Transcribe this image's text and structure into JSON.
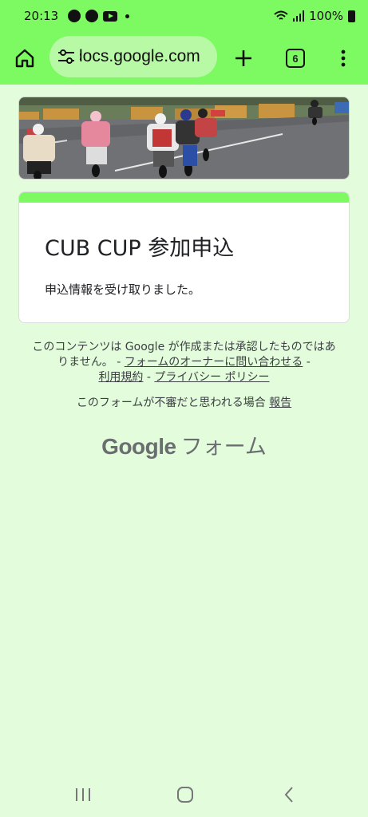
{
  "status_bar": {
    "time": "20:13",
    "battery": "100%",
    "notification_icons": [
      "chrome-icon",
      "line-icon",
      "youtube-icon"
    ]
  },
  "browser": {
    "url": "docs.google.com",
    "tab_count": "6"
  },
  "form": {
    "title": "CUB CUP 参加申込",
    "confirmation": "申込情報を受け取りました。",
    "accent_color": "#7dfa62",
    "background_color": "#e3fcdc"
  },
  "footer": {
    "disclaimer_prefix": "このコンテンツは Google が作成または承認したものではありません。 - ",
    "contact_owner": "フォームのオーナーに問い合わせる",
    "terms": "利用規約",
    "privacy": "プライバシー ポリシー",
    "report_prefix": "このフォームが不審だと思われる場合",
    "report_link": "報告",
    "brand_google": "Google",
    "brand_forms": "フォーム"
  }
}
